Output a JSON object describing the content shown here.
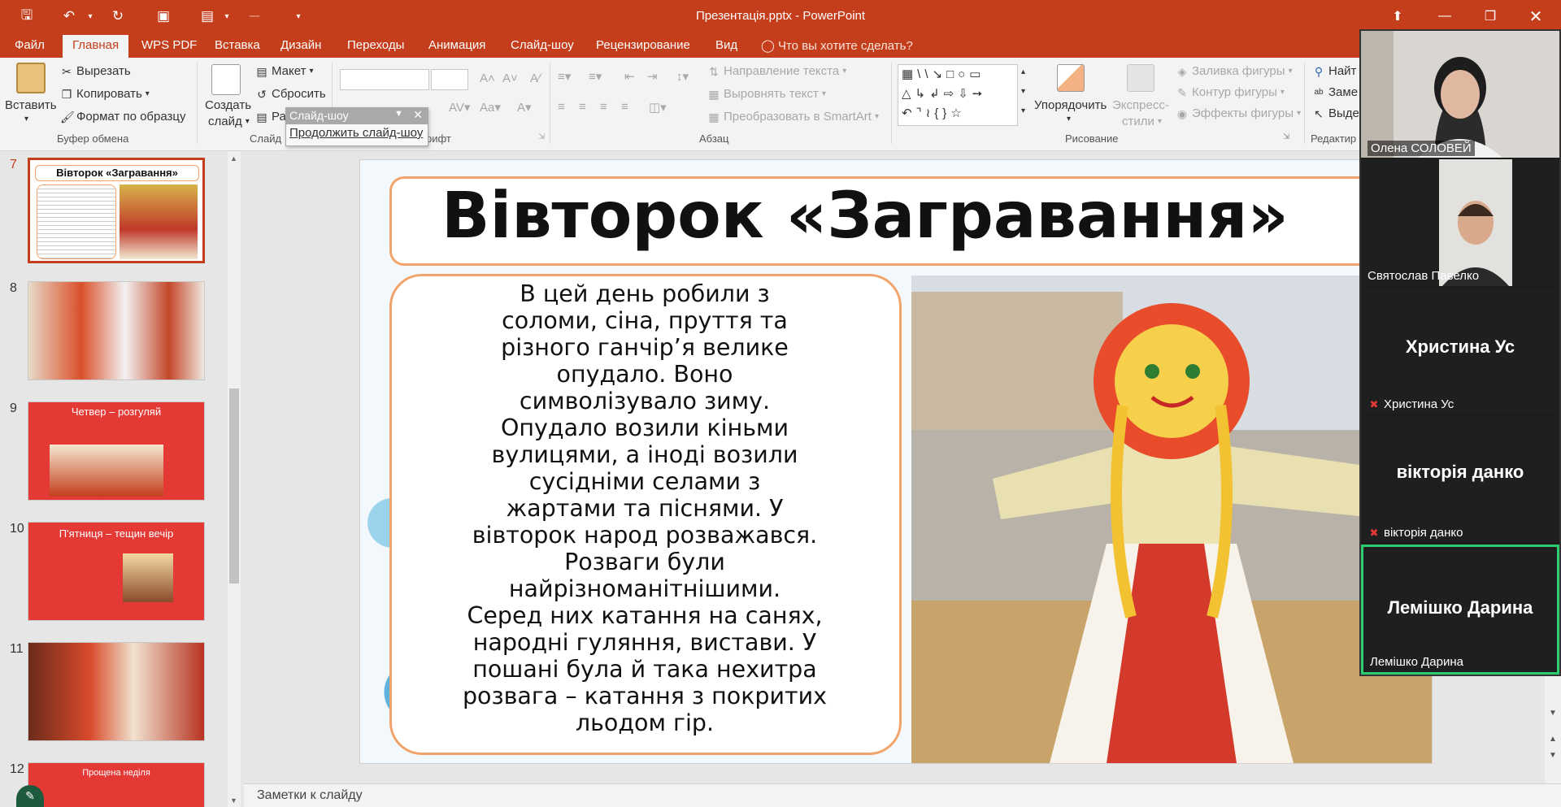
{
  "window": {
    "title": "Презентація.pptx - PowerPoint",
    "accent": "#c43e1c"
  },
  "quick_access": {
    "save_icon": "save-icon",
    "undo_icon": "undo-icon",
    "redo_icon": "redo-icon"
  },
  "tabs": [
    {
      "label": "Файл"
    },
    {
      "label": "Главная"
    },
    {
      "label": "WPS PDF"
    },
    {
      "label": "Вставка"
    },
    {
      "label": "Дизайн"
    },
    {
      "label": "Переходы"
    },
    {
      "label": "Анимация"
    },
    {
      "label": "Слайд-шоу"
    },
    {
      "label": "Рецензирование"
    },
    {
      "label": "Вид"
    }
  ],
  "tell_me": "Что вы хотите сделать?",
  "ribbon": {
    "clipboard": {
      "paste": "Вставить",
      "cut": "Вырезать",
      "copy": "Копировать",
      "format_painter": "Формат по образцу",
      "group_label": "Буфер обмена"
    },
    "slides": {
      "new_slide_1": "Создать",
      "new_slide_2": "слайд",
      "layout": "Макет",
      "reset": "Сбросить",
      "section": "Ра",
      "group_label": "Слайд"
    },
    "font": {
      "group_label": "рифт"
    },
    "paragraph": {
      "text_direction": "Направление текста",
      "align_text": "Выровнять текст",
      "smartart": "Преобразовать в SmartArt",
      "group_label": "Абзац"
    },
    "drawing": {
      "arrange": "Упорядочить",
      "quick_styles_1": "Экспресс-",
      "quick_styles_2": "стили",
      "shape_fill": "Заливка фигуры",
      "shape_outline": "Контур фигуры",
      "shape_effects": "Эффекты фигуры",
      "group_label": "Рисование"
    },
    "editing": {
      "find": "Найт",
      "replace": "Заме",
      "select": "Выде",
      "group_label": "Редактир"
    }
  },
  "slideshow_menu": {
    "header": "Слайд-шоу",
    "item": "Продолжить слайд-шоу"
  },
  "thumbnails": [
    {
      "num": "7",
      "title": "Вівторок «Загравання»",
      "selected": true
    },
    {
      "num": "8",
      "title": ""
    },
    {
      "num": "9",
      "title": "Четвер – розгуляй"
    },
    {
      "num": "10",
      "title": "П'ятниця – тещин вечір"
    },
    {
      "num": "11",
      "title": ""
    },
    {
      "num": "12",
      "title": "Прощена неділя"
    }
  ],
  "slide": {
    "title": "Вівторок «Загравання»",
    "body_lines": [
      "В цей день робили з",
      "соломи, сіна, пруття та",
      "різного ганчір’я велике",
      "опудало. Воно",
      "символізувало зиму.",
      "Опудало возили кіньми",
      "вулицями, а іноді возили",
      "сусідніми селами з",
      "жартами та піснями. У",
      "вівторок народ розважався.",
      "Розваги були",
      "найрізноманітнішими.",
      "Серед них катання на санях,",
      "народні гуляння, вистави. У",
      "пошані була й така нехитра",
      "розвага – катання з покритих",
      "льодом гір."
    ]
  },
  "notes_placeholder": "Заметки к слайду",
  "participants": [
    {
      "name": "Олена СОЛОВЕЙ",
      "video": true
    },
    {
      "name": "Святослав Павелко",
      "video": true
    },
    {
      "name": "Христина Ус",
      "muted": true
    },
    {
      "name": "вікторія данко",
      "muted": true
    },
    {
      "name": "Лемішко Дарина",
      "active_speaker": true
    }
  ]
}
